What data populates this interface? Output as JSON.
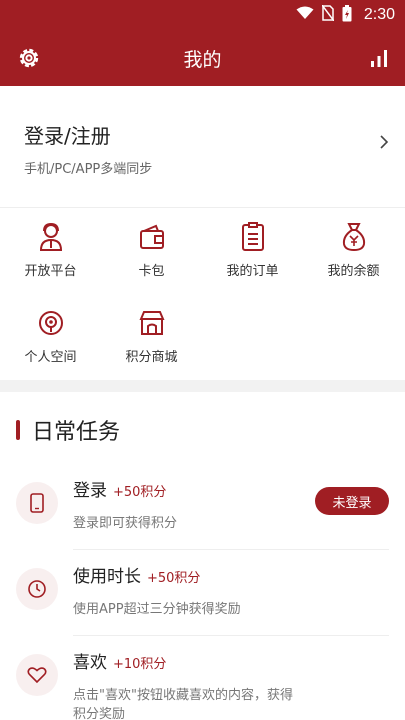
{
  "status": {
    "time": "2:30"
  },
  "appbar": {
    "title": "我的",
    "left_icon": "gear-icon",
    "right_icon": "bar-chart-icon"
  },
  "login": {
    "title": "登录/注册",
    "subtitle": "手机/PC/APP多端同步"
  },
  "grid": [
    {
      "label": "开放平台",
      "icon": "person-headset-icon"
    },
    {
      "label": "卡包",
      "icon": "wallet-icon"
    },
    {
      "label": "我的订单",
      "icon": "order-list-icon"
    },
    {
      "label": "我的余额",
      "icon": "money-bag-icon"
    },
    {
      "label": "个人空间",
      "icon": "location-target-icon"
    },
    {
      "label": "积分商城",
      "icon": "shop-icon"
    }
  ],
  "tasks": {
    "title": "日常任务",
    "items": [
      {
        "name": "登录",
        "points": "+50积分",
        "desc": "登录即可获得积分",
        "button": "未登录",
        "icon": "phone-icon"
      },
      {
        "name": "使用时长",
        "points": "+50积分",
        "desc": "使用APP超过三分钟获得奖励",
        "icon": "clock-icon"
      },
      {
        "name": "喜欢",
        "points": "+10积分",
        "desc": "点击\"喜欢\"按钮收藏喜欢的内容，获得积分奖励",
        "icon": "heart-icon"
      }
    ]
  },
  "colors": {
    "brand": "#a01e23",
    "sectionBg": "#f2f2f2"
  }
}
